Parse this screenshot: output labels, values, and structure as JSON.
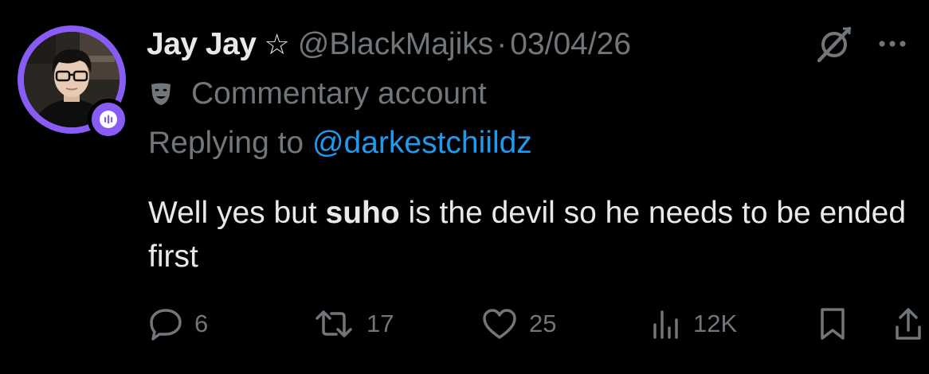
{
  "post": {
    "display_name": "Jay Jay",
    "handle": "@BlackMajiks",
    "separator": "·",
    "date": "03/04/26",
    "label_text": "Commentary account",
    "replying_prefix": "Replying to ",
    "replying_to": "@darkestchiildz",
    "body_pre": "Well yes but ",
    "body_bold": "suho",
    "body_post": " is the devil so he needs to be ended first"
  },
  "icons": {
    "name_badge": "star-outline-icon",
    "label_icon": "theater-mask-icon",
    "header_right_1": "grok-icon",
    "header_right_2": "more-icon",
    "avatar_badge": "spaces-audio-icon"
  },
  "stats": {
    "replies": "6",
    "reposts": "17",
    "likes": "25",
    "views": "12K"
  },
  "colors": {
    "background": "#000000",
    "text_primary": "#e7e9ea",
    "text_secondary": "#71767b",
    "link": "#1d9bf0",
    "avatar_ring": "#8a5cf6"
  }
}
